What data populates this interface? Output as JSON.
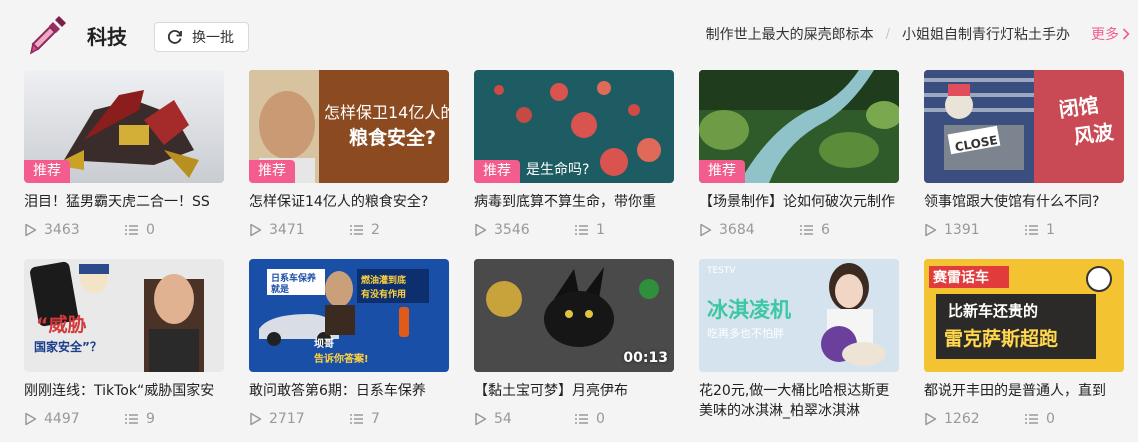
{
  "header": {
    "category_title": "科技",
    "refresh_label": "换一批",
    "hot_links": [
      "制作世上最大的屎壳郎标本",
      "小姐姐自制青行灯粘土手办"
    ],
    "hot_separator": "/",
    "more_label": "更多"
  },
  "colors": {
    "accent": "#f25d8e",
    "muted": "#999999"
  },
  "icons": {
    "category": "dropper-icon",
    "refresh": "refresh-icon",
    "play": "play-icon",
    "danmu": "danmu-icon",
    "more": "chevron-right-icon"
  },
  "cards": [
    {
      "title": "泪目！猛男霸天虎二合一！SS",
      "badge": "推荐",
      "plays": "3463",
      "danmu": "0",
      "duration": ""
    },
    {
      "title": "怎样保证14亿人的粮食安全?",
      "badge": "推荐",
      "plays": "3471",
      "danmu": "2",
      "duration": "",
      "thumb_text_1": "怎样保卫14亿人的",
      "thumb_text_2": "粮食安全?"
    },
    {
      "title": "病毒到底算不算生命，带你重",
      "badge": "推荐",
      "plays": "3546",
      "danmu": "1",
      "duration": "",
      "thumb_text_1": "是生命吗?"
    },
    {
      "title": "【场景制作】论如何破次元制作",
      "badge": "推荐",
      "plays": "3684",
      "danmu": "6",
      "duration": ""
    },
    {
      "title": "领事馆跟大使馆有什么不同?",
      "badge": "",
      "plays": "1391",
      "danmu": "1",
      "duration": "",
      "thumb_text_1": "闭馆",
      "thumb_text_2": "风波",
      "thumb_text_3": "CLOSE"
    },
    {
      "title": "刚刚连线：TikTok“威胁国家安",
      "badge": "",
      "plays": "4497",
      "danmu": "9",
      "duration": "",
      "thumb_text_1": "“威胁",
      "thumb_text_2": "国家安全”？"
    },
    {
      "title": "敢问敢答第6期：日系车保养",
      "badge": "",
      "plays": "2717",
      "danmu": "7",
      "duration": "",
      "thumb_text_1": "日系车保养",
      "thumb_text_2": "就是",
      "thumb_text_3": "燃油灌到底",
      "thumb_text_4": "有没有作用",
      "thumb_text_5": "坝哥",
      "thumb_text_6": "告诉你答案!"
    },
    {
      "title": "【黏土宝可梦】月亮伊布",
      "badge": "",
      "plays": "54",
      "danmu": "0",
      "duration": "00:13"
    },
    {
      "title": "花20元,做一大桶比哈根达斯更美味的冰淇淋_柏翠冰淇淋",
      "badge": "",
      "plays": "",
      "danmu": "",
      "duration": "",
      "thumb_text_1": "冰淇凌机",
      "thumb_text_2": "吃再多也不怕胖",
      "thumb_text_3": "TESTV"
    },
    {
      "title": "都说开丰田的是普通人，直到",
      "badge": "",
      "plays": "1262",
      "danmu": "0",
      "duration": "",
      "thumb_text_1": "赛雷话车",
      "thumb_text_2": "比新车还贵的",
      "thumb_text_3": "雷克萨斯超跑"
    }
  ]
}
